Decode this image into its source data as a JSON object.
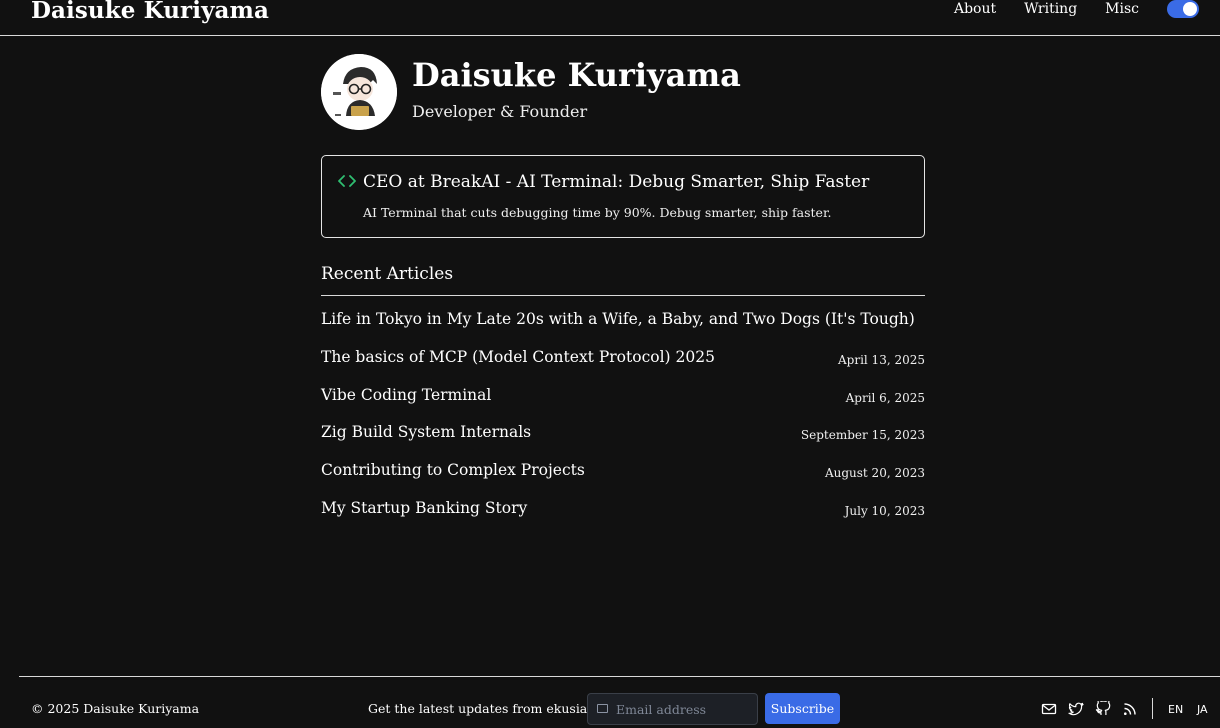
{
  "header": {
    "site_title": "Daisuke Kuriyama",
    "nav": [
      "About",
      "Writing",
      "Misc"
    ]
  },
  "profile": {
    "name": "Daisuke Kuriyama",
    "role": "Developer & Founder",
    "avatar_icon": "avatar-illustration"
  },
  "featured": {
    "icon": "code-icon",
    "icon_color": "#2fbf71",
    "title": "CEO at BreakAI - AI Terminal: Debug Smarter, Ship Faster",
    "description": "AI Terminal that cuts debugging time by 90%. Debug smarter, ship faster."
  },
  "recent": {
    "heading": "Recent Articles",
    "articles": [
      {
        "title": "Life in Tokyo in My Late 20s with a Wife, a Baby, and Two Dogs (It's Tough)",
        "date": ""
      },
      {
        "title": "The basics of MCP (Model Context Protocol) 2025",
        "date": "April 13, 2025"
      },
      {
        "title": "Vibe Coding Terminal",
        "date": "April 6, 2025"
      },
      {
        "title": "Zig Build System Internals",
        "date": "September 15, 2023"
      },
      {
        "title": "Contributing to Complex Projects",
        "date": "August 20, 2023"
      },
      {
        "title": "My Startup Banking Story",
        "date": "July 10, 2023"
      }
    ]
  },
  "footer": {
    "copyright": "© 2025 Daisuke Kuriyama",
    "newsletter_text": "Get the latest updates from ekusiadadus",
    "email_placeholder": "Email address",
    "subscribe_label": "Subscribe",
    "icons": [
      "mail-icon",
      "twitter-icon",
      "github-icon",
      "rss-icon"
    ],
    "languages": [
      "EN",
      "JA"
    ]
  },
  "colors": {
    "background": "#111111",
    "accent": "#3a6be6"
  }
}
